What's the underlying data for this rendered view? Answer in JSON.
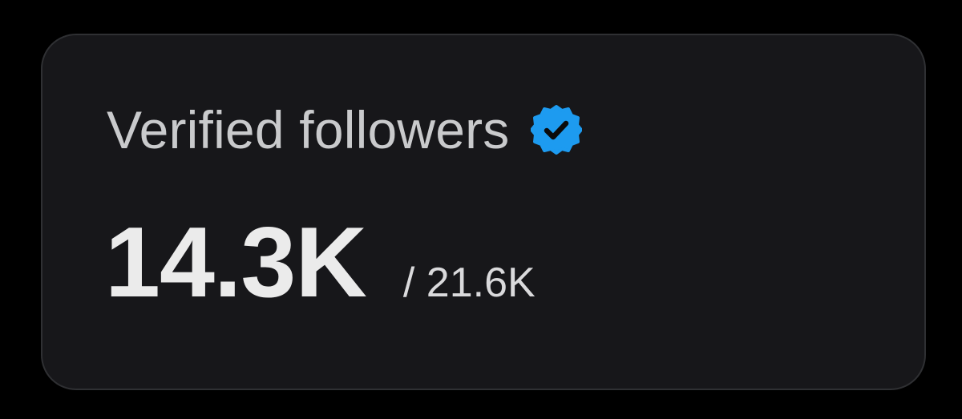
{
  "card": {
    "title": "Verified followers",
    "badge_icon": "verified-badge-icon",
    "badge_color": "#1d9bf0",
    "value": "14.3K",
    "total": "/ 21.6K"
  },
  "colors": {
    "background": "#000000",
    "card_background": "#17171a",
    "card_border": "#2f3033",
    "title_text": "#c9cacc",
    "value_text": "#ebebeb"
  }
}
